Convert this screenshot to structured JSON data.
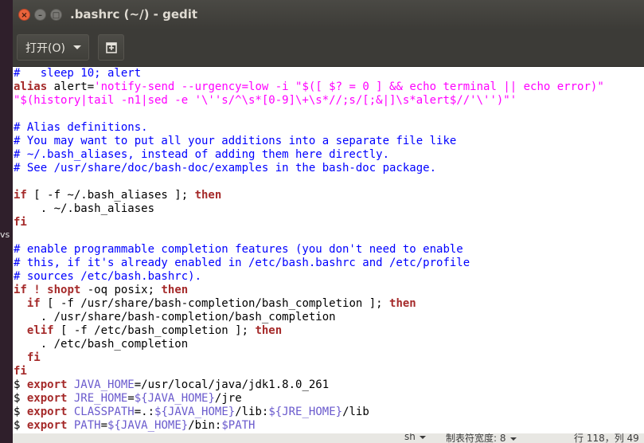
{
  "desktop": {
    "side_text": "vs"
  },
  "window": {
    "title": ".bashrc (~/) - gedit",
    "close_glyph": "×",
    "min_glyph": "–",
    "max_glyph": "□"
  },
  "toolbar": {
    "open_label": "打开(O)"
  },
  "editor": {
    "lines": [
      [
        {
          "t": "#   sleep 10; alert",
          "c": "comment"
        }
      ],
      [
        {
          "t": "alias",
          "c": "kw-plain"
        },
        {
          "t": " alert=",
          "c": "plain"
        },
        {
          "t": "'notify-send --urgency=low -i \"$([ $? = 0 ] && echo terminal || echo error)\"",
          "c": "str"
        }
      ],
      [
        {
          "t": "\"$(history|tail -n1|sed -e '\\''s/^\\s*[0-9]\\+\\s*//;s/[;&|]\\s*alert$//'\\'')\"'",
          "c": "str"
        }
      ],
      [
        {
          "t": "",
          "c": "plain"
        }
      ],
      [
        {
          "t": "# Alias definitions.",
          "c": "comment"
        }
      ],
      [
        {
          "t": "# You may want to put all your additions into a separate file like",
          "c": "comment"
        }
      ],
      [
        {
          "t": "# ~/.bash_aliases, instead of adding them here directly.",
          "c": "comment"
        }
      ],
      [
        {
          "t": "# See /usr/share/doc/bash-doc/examples in the bash-doc package.",
          "c": "comment"
        }
      ],
      [
        {
          "t": "",
          "c": "plain"
        }
      ],
      [
        {
          "t": "if",
          "c": "kw"
        },
        {
          "t": " [ -f ~/.bash_aliases ]; ",
          "c": "plain"
        },
        {
          "t": "then",
          "c": "kw"
        }
      ],
      [
        {
          "t": "    . ~/.bash_aliases",
          "c": "plain"
        }
      ],
      [
        {
          "t": "fi",
          "c": "kw"
        }
      ],
      [
        {
          "t": "",
          "c": "plain"
        }
      ],
      [
        {
          "t": "# enable programmable completion features (you don't need to enable",
          "c": "comment"
        }
      ],
      [
        {
          "t": "# this, if it's already enabled in /etc/bash.bashrc and /etc/profile",
          "c": "comment"
        }
      ],
      [
        {
          "t": "# sources /etc/bash.bashrc).",
          "c": "comment"
        }
      ],
      [
        {
          "t": "if",
          "c": "kw"
        },
        {
          "t": " ",
          "c": "plain"
        },
        {
          "t": "! shopt",
          "c": "kw"
        },
        {
          "t": " -oq posix; ",
          "c": "plain"
        },
        {
          "t": "then",
          "c": "kw"
        }
      ],
      [
        {
          "t": "  ",
          "c": "plain"
        },
        {
          "t": "if",
          "c": "kw"
        },
        {
          "t": " [ -f /usr/share/bash-completion/bash_completion ]; ",
          "c": "plain"
        },
        {
          "t": "then",
          "c": "kw"
        }
      ],
      [
        {
          "t": "    . /usr/share/bash-completion/bash_completion",
          "c": "plain"
        }
      ],
      [
        {
          "t": "  ",
          "c": "plain"
        },
        {
          "t": "elif",
          "c": "kw"
        },
        {
          "t": " [ -f /etc/bash_completion ]; ",
          "c": "plain"
        },
        {
          "t": "then",
          "c": "kw"
        }
      ],
      [
        {
          "t": "    . /etc/bash_completion",
          "c": "plain"
        }
      ],
      [
        {
          "t": "  ",
          "c": "plain"
        },
        {
          "t": "fi",
          "c": "kw"
        }
      ],
      [
        {
          "t": "fi",
          "c": "kw"
        }
      ],
      [
        {
          "t": "$ ",
          "c": "plain"
        },
        {
          "t": "export",
          "c": "kw"
        },
        {
          "t": " ",
          "c": "plain"
        },
        {
          "t": "JAVA_HOME",
          "c": "var"
        },
        {
          "t": "=/usr/local/java/jdk1.8.0_261",
          "c": "plain"
        }
      ],
      [
        {
          "t": "$ ",
          "c": "plain"
        },
        {
          "t": "export",
          "c": "kw"
        },
        {
          "t": " ",
          "c": "plain"
        },
        {
          "t": "JRE_HOME",
          "c": "var"
        },
        {
          "t": "=",
          "c": "plain"
        },
        {
          "t": "${JAVA_HOME}",
          "c": "var"
        },
        {
          "t": "/jre",
          "c": "plain"
        }
      ],
      [
        {
          "t": "$ ",
          "c": "plain"
        },
        {
          "t": "export",
          "c": "kw"
        },
        {
          "t": " ",
          "c": "plain"
        },
        {
          "t": "CLASSPATH",
          "c": "var"
        },
        {
          "t": "=.:",
          "c": "plain"
        },
        {
          "t": "${JAVA_HOME}",
          "c": "var"
        },
        {
          "t": "/lib:",
          "c": "plain"
        },
        {
          "t": "${JRE_HOME}",
          "c": "var"
        },
        {
          "t": "/lib",
          "c": "plain"
        }
      ],
      [
        {
          "t": "$ ",
          "c": "plain"
        },
        {
          "t": "export",
          "c": "kw"
        },
        {
          "t": " ",
          "c": "plain"
        },
        {
          "t": "PATH",
          "c": "var"
        },
        {
          "t": "=",
          "c": "plain"
        },
        {
          "t": "${JAVA_HOME}",
          "c": "var"
        },
        {
          "t": "/bin:",
          "c": "plain"
        },
        {
          "t": "$PATH",
          "c": "var"
        }
      ]
    ]
  },
  "statusbar": {
    "language": "sh",
    "tab_width": "制表符宽度: 8",
    "position": "行 118，列 49"
  },
  "colors": {
    "comment": "#0000ff",
    "keyword": "#a52a2a",
    "string": "#ff00ff",
    "variable": "#6a5acd",
    "titlebar": "#3c3b37",
    "close_button": "#e9633b"
  }
}
